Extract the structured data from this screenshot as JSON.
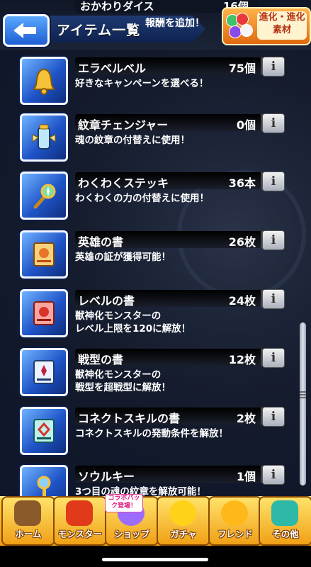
{
  "header": {
    "prev_item_name": "おかわりダイス",
    "prev_item_count": "16個",
    "title": "アイテム一覧",
    "subtitle_fragment": "報酬を追加！",
    "evolve_button_label": "進化・進化素材"
  },
  "items": [
    {
      "name": "エラベルベル",
      "count": "75個",
      "desc": "好きなキャンペーンを選べる！",
      "icon": "bell-icon"
    },
    {
      "name": "紋章チェンジャー",
      "count": "0個",
      "desc": "魂の紋章の付替えに使用！",
      "icon": "emblem-changer-icon"
    },
    {
      "name": "わくわくステッキ",
      "count": "36本",
      "desc": "わくわくの力の付替えに使用！",
      "icon": "wand-icon"
    },
    {
      "name": "英雄の書",
      "count": "26枚",
      "desc": "英雄の証が獲得可能！",
      "icon": "hero-scroll-icon"
    },
    {
      "name": "レベルの書",
      "count": "24枚",
      "desc": "獣神化モンスターの\nレベル上限を120に解放！",
      "icon": "level-scroll-icon"
    },
    {
      "name": "戦型の書",
      "count": "12枚",
      "desc": "獣神化モンスターの\n戦型を超戦型に解放！",
      "icon": "battle-scroll-icon"
    },
    {
      "name": "コネクトスキルの書",
      "count": "2枚",
      "desc": "コネクトスキルの発動条件を解放！",
      "icon": "connect-scroll-icon"
    },
    {
      "name": "ソウルキー",
      "count": "1個",
      "desc": "3つ目の魂の紋章を解放可能！",
      "icon": "soul-key-icon"
    }
  ],
  "tabs": [
    {
      "label": "ホーム",
      "icon": "home-icon",
      "color": "#8b5a2b"
    },
    {
      "label": "モンスター",
      "icon": "monster-icon",
      "color": "#e03a1a"
    },
    {
      "label": "ショップ",
      "icon": "shop-orb-icon",
      "color": "#9b6cff"
    },
    {
      "label": "ガチャ",
      "icon": "gacha-icon",
      "color": "#ffd21a"
    },
    {
      "label": "フレンド",
      "icon": "friend-icon",
      "color": "#ffb81a"
    },
    {
      "label": "その他",
      "icon": "other-icon",
      "color": "#2db8a8"
    }
  ],
  "collab_badge": "コラボパック登場！",
  "info_label": "i"
}
